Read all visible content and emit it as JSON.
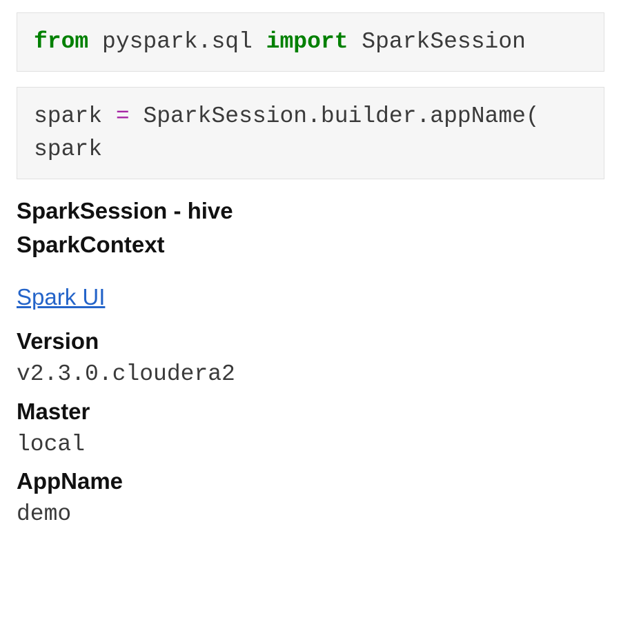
{
  "cell1": {
    "kw_from": "from",
    "module": " pyspark.sql ",
    "kw_import": "import",
    "name": " SparkSession"
  },
  "cell2": {
    "line1_pre": "spark ",
    "line1_op": "=",
    "line1_post": " SparkSession.builder.appName(",
    "line2": "spark"
  },
  "output": {
    "heading": "SparkSession - hive",
    "subheading": "SparkContext",
    "spark_ui": "Spark UI",
    "version_label": "Version",
    "version_value": "v2.3.0.cloudera2",
    "master_label": "Master",
    "master_value": "local",
    "appname_label": "AppName",
    "appname_value": "demo"
  }
}
